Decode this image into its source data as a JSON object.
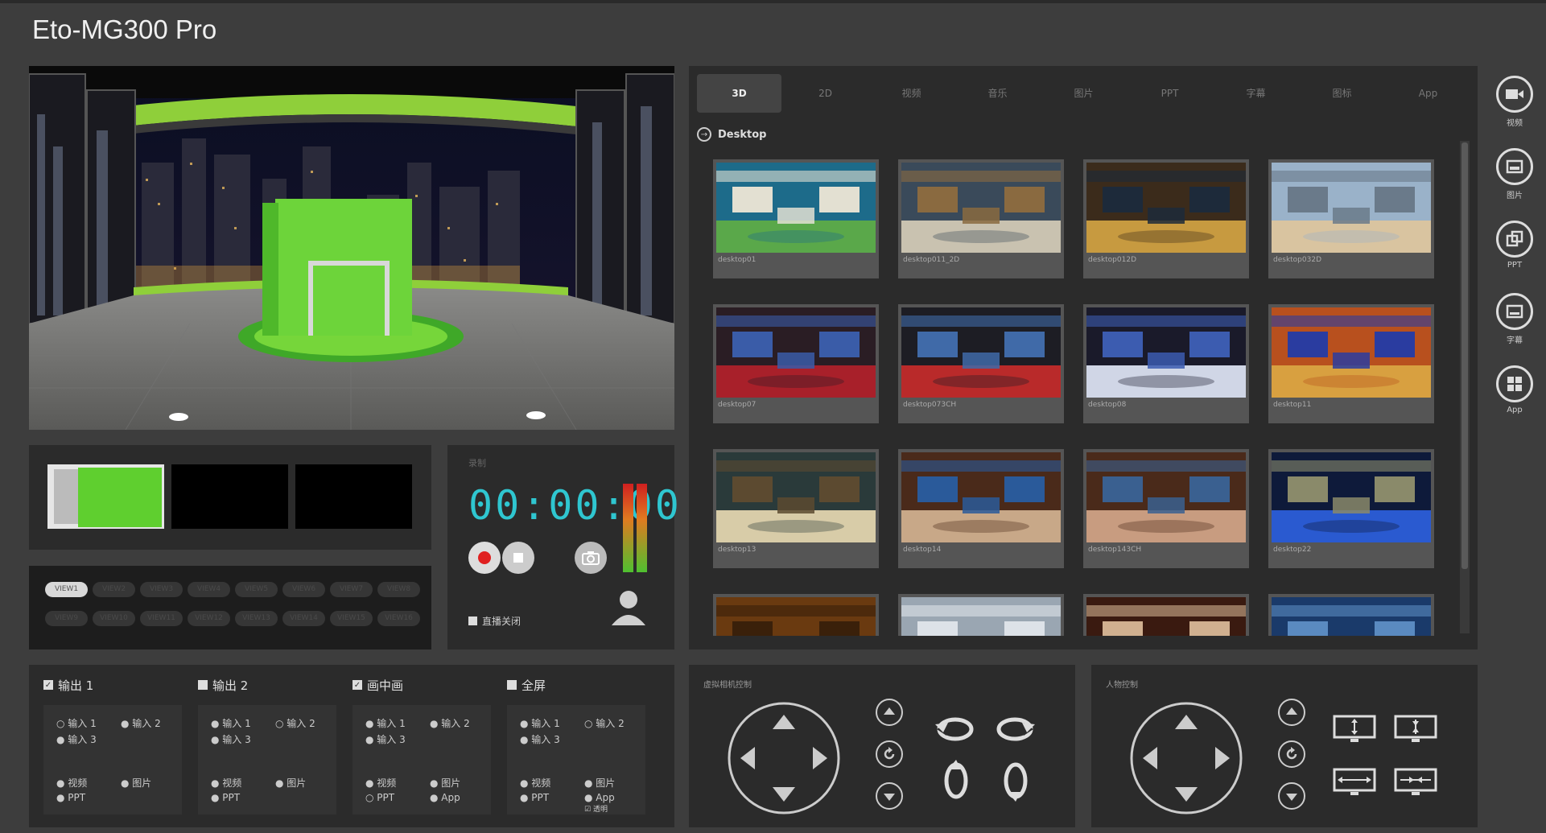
{
  "app": {
    "title": "Eto-MG300 Pro"
  },
  "tabs": [
    "3D",
    "2D",
    "视频",
    "音乐",
    "图片",
    "PPT",
    "字幕",
    "图标",
    "App"
  ],
  "library": {
    "folder": "Desktop",
    "items": [
      {
        "label": "desktop01",
        "palette": [
          "#1d6b8a",
          "#5aa84a",
          "#e3e0d2"
        ]
      },
      {
        "label": "desktop011_2D",
        "palette": [
          "#3a4a5a",
          "#c9c2b0",
          "#8a6a40"
        ]
      },
      {
        "label": "desktop012D",
        "palette": [
          "#3b2b1b",
          "#c79a40",
          "#1d2a3a"
        ]
      },
      {
        "label": "desktop032D",
        "palette": [
          "#9ab2c9",
          "#d9c4a0",
          "#6a7a8a"
        ]
      },
      {
        "label": "desktop07",
        "palette": [
          "#2a1d24",
          "#a8202a",
          "#3a5ca8"
        ]
      },
      {
        "label": "desktop073CH",
        "palette": [
          "#1d1d24",
          "#b92a2a",
          "#406aa8"
        ]
      },
      {
        "label": "desktop08",
        "palette": [
          "#1a1a2a",
          "#d0d6e6",
          "#3c5cb0"
        ]
      },
      {
        "label": "desktop11",
        "palette": [
          "#b8501e",
          "#d8a040",
          "#2a3ca0"
        ]
      },
      {
        "label": "desktop13",
        "palette": [
          "#2a3a3a",
          "#d8cca8",
          "#5c4a30"
        ]
      },
      {
        "label": "desktop14",
        "palette": [
          "#4a2a1a",
          "#c8a888",
          "#2a5a9a"
        ]
      },
      {
        "label": "desktop143CH",
        "palette": [
          "#4a2a1a",
          "#c89c80",
          "#3a6090"
        ]
      },
      {
        "label": "desktop22",
        "palette": [
          "#0e1a3a",
          "#2a5ad0",
          "#8a8a6a"
        ]
      },
      {
        "label": "",
        "palette": [
          "#6a3a10",
          "#c88a30",
          "#3a200a"
        ]
      },
      {
        "label": "",
        "palette": [
          "#9aa6b2",
          "#3a6ab0",
          "#dde2e8"
        ]
      },
      {
        "label": "",
        "palette": [
          "#3a1a10",
          "#a04a20",
          "#d0b090"
        ]
      },
      {
        "label": "",
        "palette": [
          "#1a3a6a",
          "#c88a3a",
          "#5a8ac0"
        ]
      }
    ]
  },
  "recorder": {
    "section_label": "录制",
    "time": "00:00:00",
    "live_label": "直播关闭"
  },
  "views": {
    "row1": [
      "VIEW1",
      "VIEW2",
      "VIEW3",
      "VIEW4",
      "VIEW5",
      "VIEW6",
      "VIEW7",
      "VIEW8"
    ],
    "row2": [
      "VIEW9",
      "VIEW10",
      "VIEW11",
      "VIEW12",
      "VIEW13",
      "VIEW14",
      "VIEW15",
      "VIEW16"
    ]
  },
  "outputs": [
    {
      "title": "输出 1",
      "checked": true,
      "inputs": [
        "输入 1",
        "输入 2",
        "输入 3"
      ],
      "sources": [
        "视频",
        "图片",
        "PPT"
      ],
      "extra": null
    },
    {
      "title": "输出 2",
      "checked": false,
      "inputs": [
        "输入 1",
        "输入 2",
        "输入 3"
      ],
      "sources": [
        "视频",
        "图片",
        "PPT"
      ],
      "extra": null
    },
    {
      "title": "画中画",
      "checked": true,
      "inputs": [
        "输入 1",
        "输入 2",
        "输入 3"
      ],
      "sources": [
        "视频",
        "图片",
        "PPT",
        "App"
      ],
      "extra": null
    },
    {
      "title": "全屏",
      "checked": false,
      "inputs": [
        "输入 1",
        "输入 2",
        "输入 3"
      ],
      "sources": [
        "视频",
        "图片",
        "PPT",
        "App"
      ],
      "extra": "透明"
    }
  ],
  "camera_control": {
    "title": "虚拟相机控制"
  },
  "person_control": {
    "title": "人物控制"
  },
  "sidebar": [
    {
      "label": "视频",
      "icon": "video-camera-icon"
    },
    {
      "label": "图片",
      "icon": "picture-icon"
    },
    {
      "label": "PPT",
      "icon": "ppt-icon"
    },
    {
      "label": "字幕",
      "icon": "subtitle-icon"
    },
    {
      "label": "App",
      "icon": "windows-app-icon"
    }
  ]
}
